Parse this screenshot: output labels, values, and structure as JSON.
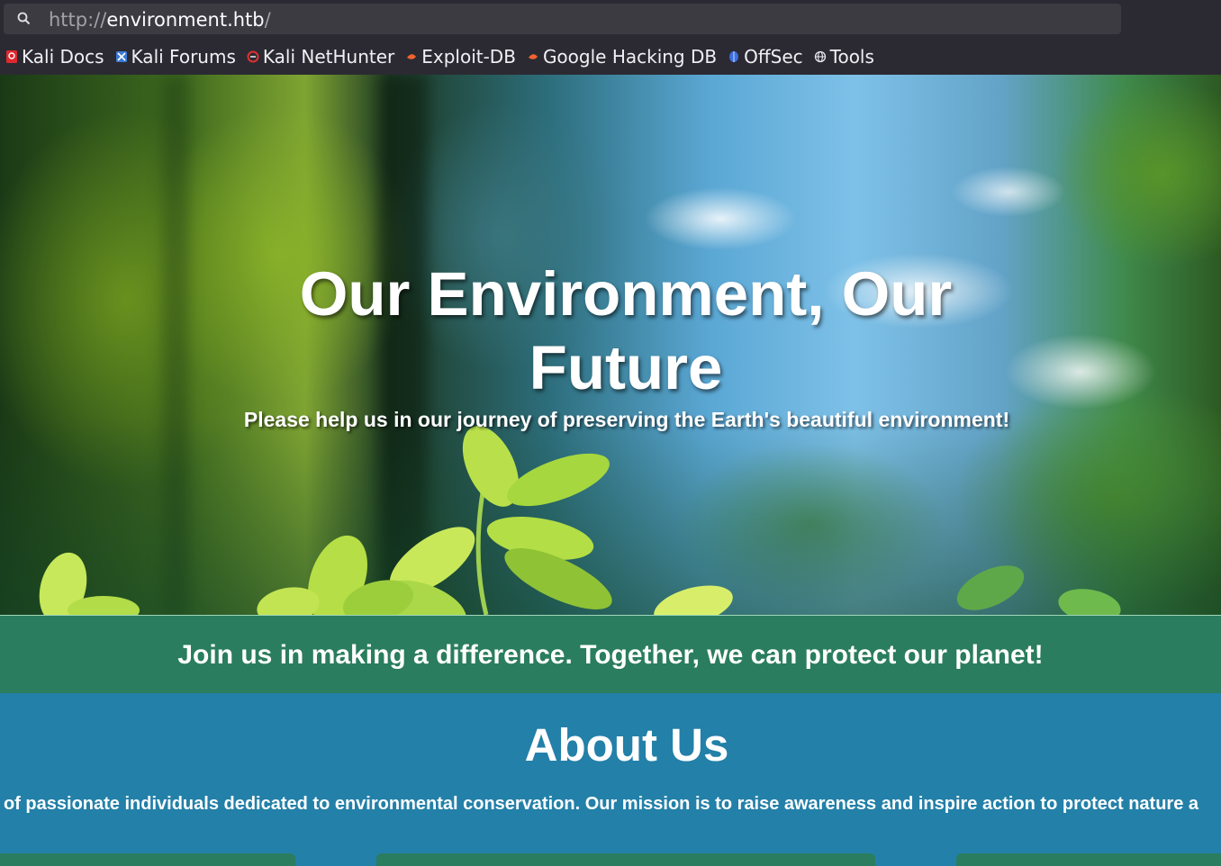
{
  "browser": {
    "url_scheme": "http://",
    "url_host": "environment.htb",
    "url_trail": "/",
    "bookmarks": [
      {
        "label": "Kali Docs",
        "icon": "kali-docs-icon"
      },
      {
        "label": "Kali Forums",
        "icon": "kali-forums-icon"
      },
      {
        "label": "Kali NetHunter",
        "icon": "kali-nethunter-icon"
      },
      {
        "label": "Exploit-DB",
        "icon": "exploit-db-icon"
      },
      {
        "label": "Google Hacking DB",
        "icon": "google-hacking-db-icon"
      },
      {
        "label": "OffSec",
        "icon": "offsec-icon"
      },
      {
        "label": "Tools",
        "icon": "globe-icon"
      }
    ]
  },
  "hero": {
    "title": "Our Environment, Our Future",
    "subtitle": "Please help us in our journey of preserving the Earth's beautiful environment!"
  },
  "cta": {
    "text": "Join us in making a difference. Together, we can protect our planet!"
  },
  "about": {
    "title": "About Us",
    "text": "of passionate individuals dedicated to environmental conservation. Our mission is to raise awareness and inspire action to protect nature a"
  },
  "colors": {
    "chrome_bg": "#2b2a33",
    "urlbar_bg": "#3c3b42",
    "cta_green": "#2a7d5e",
    "about_blue": "#2380a8"
  }
}
